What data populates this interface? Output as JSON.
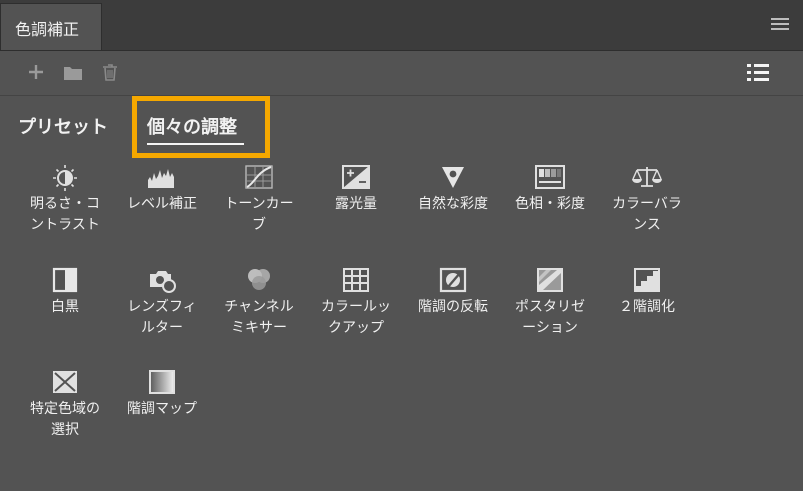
{
  "panel": {
    "title": "色調補正"
  },
  "tabs": {
    "preset": "プリセット",
    "individual": "個々の調整"
  },
  "accent": "#f5a800",
  "toolbar": {
    "add": "add-icon",
    "folder": "folder-icon",
    "trash": "trash-icon",
    "list_view": "list-view-icon"
  },
  "adjustments": [
    {
      "label": "明るさ・コ\nントラスト",
      "icon": "brightness-contrast-icon"
    },
    {
      "label": "レベル補正",
      "icon": "levels-icon"
    },
    {
      "label": "トーンカー\nブ",
      "icon": "curves-icon"
    },
    {
      "label": "露光量",
      "icon": "exposure-icon"
    },
    {
      "label": "自然な彩度",
      "icon": "vibrance-icon"
    },
    {
      "label": "色相・彩度",
      "icon": "hue-saturation-icon"
    },
    {
      "label": "カラーバラ\nンス",
      "icon": "color-balance-icon"
    },
    {
      "label": "白黒",
      "icon": "black-white-icon"
    },
    {
      "label": "レンズフィ\nルター",
      "icon": "photo-filter-icon"
    },
    {
      "label": "チャンネル\nミキサー",
      "icon": "channel-mixer-icon"
    },
    {
      "label": "カラールッ\nクアップ",
      "icon": "color-lookup-icon"
    },
    {
      "label": "階調の反転",
      "icon": "invert-icon"
    },
    {
      "label": "ポスタリゼ\nーション",
      "icon": "posterize-icon"
    },
    {
      "label": "２階調化",
      "icon": "threshold-icon"
    },
    {
      "label": "特定色域の\n選択",
      "icon": "selective-color-icon"
    },
    {
      "label": "階調マップ",
      "icon": "gradient-map-icon"
    }
  ]
}
